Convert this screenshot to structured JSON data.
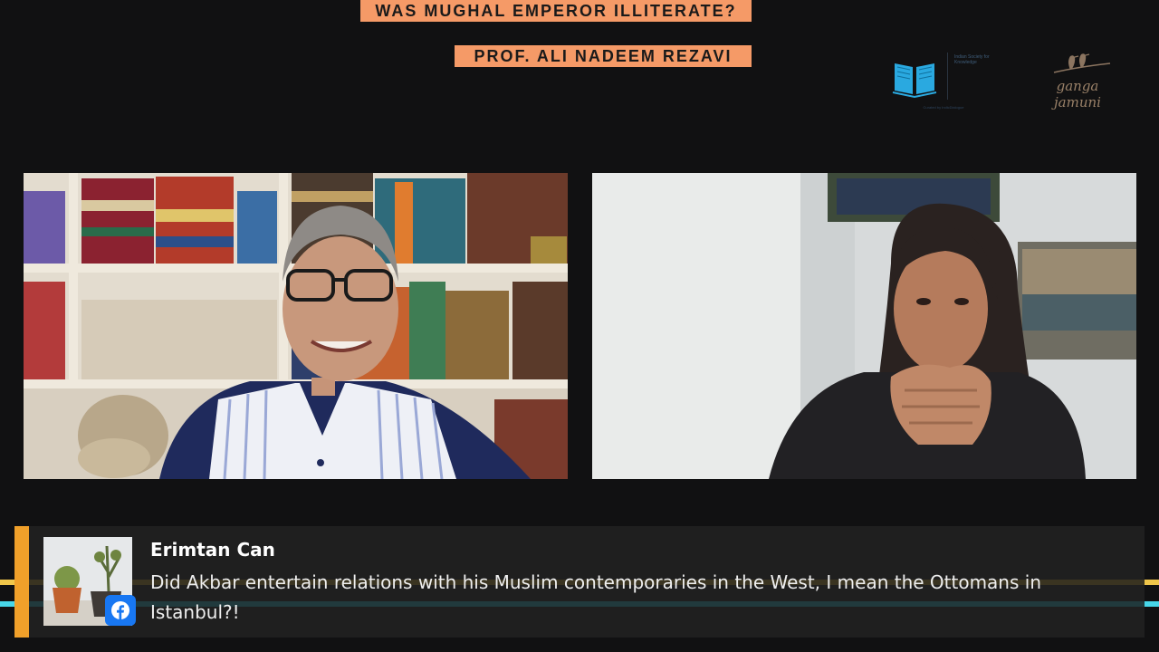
{
  "banners": {
    "topic": "WAS MUGHAL EMPEROR ILLITERATE?",
    "speaker": "PROF. ALI NADEEM REZAVI"
  },
  "logos": {
    "library_small_text": "Indian Society for Knowledge",
    "library_tagline": "Curated by IndicDialogue",
    "ganga_jamuni": "ganga jamuni",
    "book_icon": "open-book-icon",
    "birds_icon": "birds-on-branch-icon"
  },
  "comment": {
    "author": "Erimtan Can",
    "text": "Did Akbar entertain relations with his Muslim contemporaries in the West, I mean the Ottomans in Istanbul?!",
    "platform_icon": "facebook-icon"
  },
  "colors": {
    "background": "#111112",
    "banner": "#f59a67",
    "accent": "#f0a02a",
    "facebook": "#1877f2",
    "card": "#1f1f1f"
  }
}
